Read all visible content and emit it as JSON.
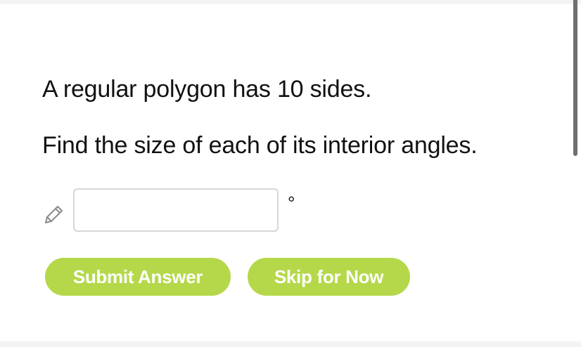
{
  "question": {
    "line1": "A regular polygon has 10 sides.",
    "line2": "Find the size of each of its interior angles."
  },
  "answer": {
    "value": "",
    "placeholder": "",
    "unit_symbol": "°",
    "icon": "pencil-icon"
  },
  "actions": {
    "submit_label": "Submit Answer",
    "skip_label": "Skip for Now"
  },
  "colors": {
    "button_bg": "#b5d84a",
    "button_text": "#ffffff",
    "text": "#111111",
    "input_border": "#d6d6d6"
  }
}
